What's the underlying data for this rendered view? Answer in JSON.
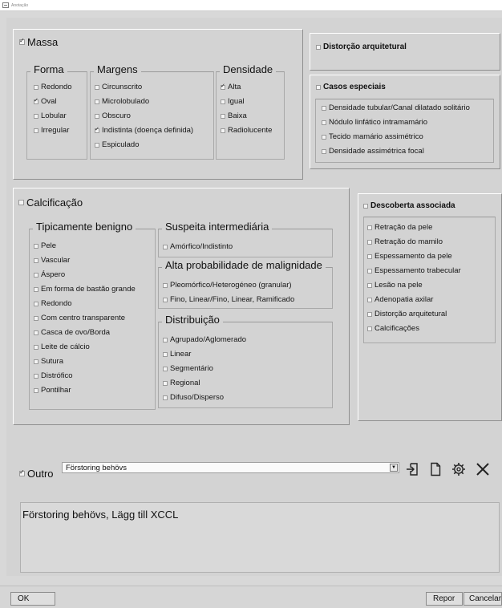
{
  "window": {
    "title": "Anotação"
  },
  "massa": {
    "title": "Massa",
    "checked": true,
    "forma": {
      "title": "Forma",
      "items": [
        {
          "label": "Redondo",
          "checked": false
        },
        {
          "label": "Oval",
          "checked": true
        },
        {
          "label": "Lobular",
          "checked": false
        },
        {
          "label": "Irregular",
          "checked": false
        }
      ]
    },
    "margens": {
      "title": "Margens",
      "items": [
        {
          "label": "Circunscrito",
          "checked": false
        },
        {
          "label": "Microlobulado",
          "checked": false
        },
        {
          "label": "Obscuro",
          "checked": false
        },
        {
          "label": "Indistinta (doença definida)",
          "checked": true
        },
        {
          "label": "Espiculado",
          "checked": false
        }
      ]
    },
    "densidade": {
      "title": "Densidade",
      "items": [
        {
          "label": "Alta",
          "checked": true
        },
        {
          "label": "Igual",
          "checked": false
        },
        {
          "label": "Baixa",
          "checked": false
        },
        {
          "label": "Radiolucente",
          "checked": false
        }
      ]
    }
  },
  "distorcao": {
    "title": "Distorção arquitetural",
    "checked": false
  },
  "casos": {
    "title": "Casos especiais",
    "checked": false,
    "items": [
      {
        "label": "Densidade tubular/Canal dilatado solitário",
        "checked": false
      },
      {
        "label": "Nódulo linfático intramamário",
        "checked": false
      },
      {
        "label": "Tecido mamário assimétrico",
        "checked": false
      },
      {
        "label": "Densidade assimétrica focal",
        "checked": false
      }
    ]
  },
  "calcificacao": {
    "title": "Calcificação",
    "checked": false,
    "benigno": {
      "title": "Tipicamente benigno",
      "items": [
        {
          "label": "Pele"
        },
        {
          "label": "Vascular"
        },
        {
          "label": "Áspero"
        },
        {
          "label": "Em forma de bastão grande"
        },
        {
          "label": "Redondo"
        },
        {
          "label": "Com centro transparente"
        },
        {
          "label": "Casca de ovo/Borda"
        },
        {
          "label": "Leite de cálcio"
        },
        {
          "label": "Sutura"
        },
        {
          "label": "Distrófico"
        },
        {
          "label": "Pontilhar"
        }
      ]
    },
    "suspeita": {
      "title": "Suspeita intermediária",
      "items": [
        {
          "label": "Amórfico/Indistinto"
        }
      ]
    },
    "alta": {
      "title": "Alta probabilidade de malignidade",
      "items": [
        {
          "label": "Pleomórfico/Heterogéneo (granular)"
        },
        {
          "label": "Fino, Linear/Fino, Linear, Ramificado"
        }
      ]
    },
    "distribuicao": {
      "title": "Distribuição",
      "items": [
        {
          "label": "Agrupado/Aglomerado"
        },
        {
          "label": "Linear"
        },
        {
          "label": "Segmentário"
        },
        {
          "label": "Regional"
        },
        {
          "label": "Difuso/Disperso"
        }
      ]
    }
  },
  "descoberta": {
    "title": "Descoberta associada",
    "checked": false,
    "items": [
      {
        "label": "Retração da pele"
      },
      {
        "label": "Retração do mamilo"
      },
      {
        "label": "Espessamento da pele"
      },
      {
        "label": "Espessamento trabecular"
      },
      {
        "label": "Lesão na pele"
      },
      {
        "label": "Adenopatia axilar"
      },
      {
        "label": "Distorção arquitetural"
      },
      {
        "label": "Calcificações"
      }
    ]
  },
  "outro": {
    "label": "Outro",
    "checked": true,
    "selected": "Förstoring behövs",
    "text": "Förstoring behövs, Lägg till XCCL"
  },
  "footer": {
    "ok": "OK",
    "repor": "Repor",
    "cancelar": "Cancelar"
  }
}
